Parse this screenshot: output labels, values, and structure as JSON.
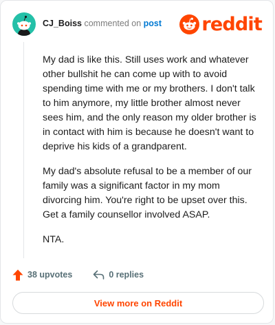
{
  "header": {
    "username": "CJ_Boiss",
    "action_text": "commented on",
    "target_link": "post",
    "logo_text": "reddit"
  },
  "comment": {
    "paragraphs": [
      "My dad is like this. Still uses work and whatever other bullshit he can come up with to avoid spending time with me or my brothers. I don't talk to him anymore, my little brother almost never sees him, and the only reason my older brother is in contact with him is because he doesn't want to deprive his kids of a grandparent.",
      "My dad's absolute refusal to be a member of our family was a significant factor in my mom divorcing him. You're right to be upset over this. Get a family counsellor involved ASAP.",
      "NTA."
    ]
  },
  "actions": {
    "upvotes_label": "38 upvotes",
    "replies_label": "0 replies"
  },
  "footer": {
    "view_more_label": "View more on Reddit"
  },
  "colors": {
    "brand": "#ff4500",
    "avatar_bg": "#24c0a8",
    "link": "#0079d3",
    "muted": "#576f76"
  },
  "icons": {
    "avatar": "snoo-avatar-icon",
    "logo": "reddit-snoo-icon",
    "upvote": "upvote-arrow-icon",
    "reply": "reply-arrow-icon"
  }
}
